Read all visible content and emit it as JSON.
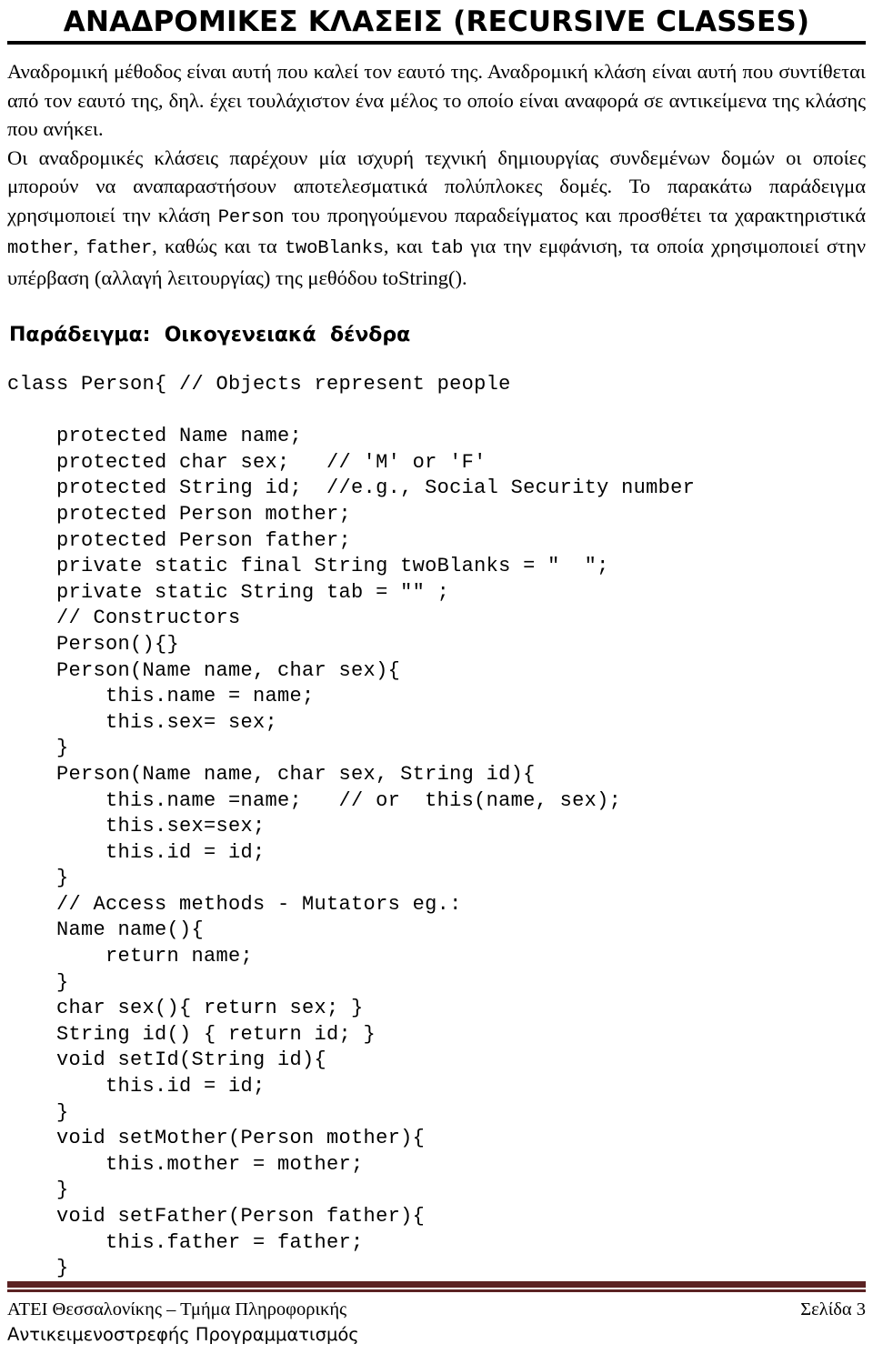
{
  "document": {
    "title": "ΑΝΑΔΡΟΜΙΚΕΣ ΚΛΑΣΕΙΣ (RECURSIVE CLASSES)",
    "language": "el"
  },
  "colors": {
    "text": "#000000",
    "background": "#ffffff",
    "footer_rule": "#5b2223"
  },
  "paragraphs": {
    "p1": "Αναδρομική μέθοδος είναι αυτή που καλεί τον εαυτό της. Αναδρομική κλάση είναι αυτή που συντίθεται από τον εαυτό της, δηλ. έχει τουλάχιστον ένα μέλος το οποίο είναι αναφορά σε αντικείμενα της κλάσης που ανήκει.",
    "p2": {
      "seg1": "Οι αναδρομικές κλάσεις παρέχουν μία ισχυρή τεχνική δημιουργίας συνδεμένων δομών οι οποίες μπορούν να αναπαραστήσουν αποτελεσματικά πολύπλοκες δομές. Το παρακάτω παράδειγμα χρησιμοποιεί την κλάση ",
      "code1": "Person",
      "seg2": " του προηγούμενου παραδείγματος και προσθέτει τα χαρακτηριστικά ",
      "code2": "mother",
      "seg3": ", ",
      "code3": "father",
      "seg4": ", καθώς και τα ",
      "code4": "twoBlanks",
      "seg5": ", και ",
      "code5": "tab",
      "seg6": " για την εμφάνιση, τα οποία χρησιμοποιεί στην υπέρβαση (αλλαγή λειτουργίας) της μεθόδου toString()."
    }
  },
  "example": {
    "heading": "Παράδειγμα:  Οικογενειακά  δένδρα"
  },
  "code": {
    "language": "java",
    "lines": [
      "class Person{ // Objects represent people",
      "",
      "    protected Name name;",
      "    protected char sex;   // 'M' or 'F'",
      "    protected String id;  //e.g., Social Security number",
      "    protected Person mother;",
      "    protected Person father;",
      "    private static final String twoBlanks = \"  \";",
      "    private static String tab = \"\" ;",
      "    // Constructors",
      "    Person(){}",
      "    Person(Name name, char sex){",
      "        this.name = name;",
      "        this.sex= sex;",
      "    }",
      "    Person(Name name, char sex, String id){",
      "        this.name =name;   // or  this(name, sex);",
      "        this.sex=sex;",
      "        this.id = id;",
      "    }",
      "    // Access methods - Mutators eg.:",
      "    Name name(){",
      "        return name;",
      "    }",
      "    char sex(){ return sex; }",
      "    String id() { return id; }",
      "    void setId(String id){",
      "        this.id = id;",
      "    }",
      "    void setMother(Person mother){",
      "        this.mother = mother;",
      "    }",
      "    void setFather(Person father){",
      "        this.father = father;",
      "    }"
    ],
    "text": "class Person{ // Objects represent people\n\n    protected Name name;\n    protected char sex;   // 'M' or 'F'\n    protected String id;  //e.g., Social Security number\n    protected Person mother;\n    protected Person father;\n    private static final String twoBlanks = \"  \";\n    private static String tab = \"\" ;\n    // Constructors\n    Person(){}\n    Person(Name name, char sex){\n        this.name = name;\n        this.sex= sex;\n    }\n    Person(Name name, char sex, String id){\n        this.name =name;   // or  this(name, sex);\n        this.sex=sex;\n        this.id = id;\n    }\n    // Access methods - Mutators eg.:\n    Name name(){\n        return name;\n    }\n    char sex(){ return sex; }\n    String id() { return id; }\n    void setId(String id){\n        this.id = id;\n    }\n    void setMother(Person mother){\n        this.mother = mother;\n    }\n    void setFather(Person father){\n        this.father = father;\n    }"
  },
  "footer": {
    "line1": "ΑΤΕΙ Θεσσαλονίκης – Τμήμα Πληροφορικής",
    "line2": "Αντικειμενοστρεφής Προγραμματισμός",
    "page_label": "Σελίδα 3"
  }
}
